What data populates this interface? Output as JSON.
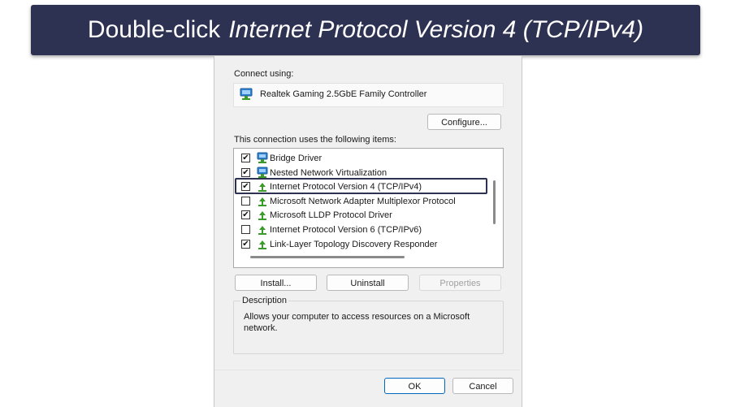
{
  "banner": {
    "prefix": "Double-click",
    "emphasis": "Internet Protocol Version 4 (TCP/IPv4)"
  },
  "dialog": {
    "connect_using_label": "Connect using:",
    "adapter_name": "Realtek Gaming 2.5GbE Family Controller",
    "adapter_icon": "network-adapter-icon",
    "configure_label": "Configure...",
    "items_label": "This connection uses the following items:",
    "items": [
      {
        "label": "Bridge Driver",
        "checked": true,
        "icon": "network-adapter-icon"
      },
      {
        "label": "Nested Network Virtualization",
        "checked": true,
        "icon": "network-adapter-icon"
      },
      {
        "label": "Internet Protocol Version 4 (TCP/IPv4)",
        "checked": true,
        "icon": "protocol-icon",
        "highlighted": true
      },
      {
        "label": "Microsoft Network Adapter Multiplexor Protocol",
        "checked": false,
        "icon": "protocol-icon"
      },
      {
        "label": "Microsoft LLDP Protocol Driver",
        "checked": true,
        "icon": "protocol-icon"
      },
      {
        "label": "Internet Protocol Version 6 (TCP/IPv6)",
        "checked": false,
        "icon": "protocol-icon"
      },
      {
        "label": "Link-Layer Topology Discovery Responder",
        "checked": true,
        "icon": "protocol-icon"
      }
    ],
    "install_label": "Install...",
    "uninstall_label": "Uninstall",
    "properties_label": "Properties",
    "description_legend": "Description",
    "description_text": "Allows your computer to access resources on a Microsoft network.",
    "ok_label": "OK",
    "cancel_label": "Cancel"
  },
  "colors": {
    "banner_bg": "#2d3152",
    "highlight_border": "#2d3152",
    "protocol_green": "#3a9a2a",
    "adapter_blue": "#2f7fd0"
  }
}
